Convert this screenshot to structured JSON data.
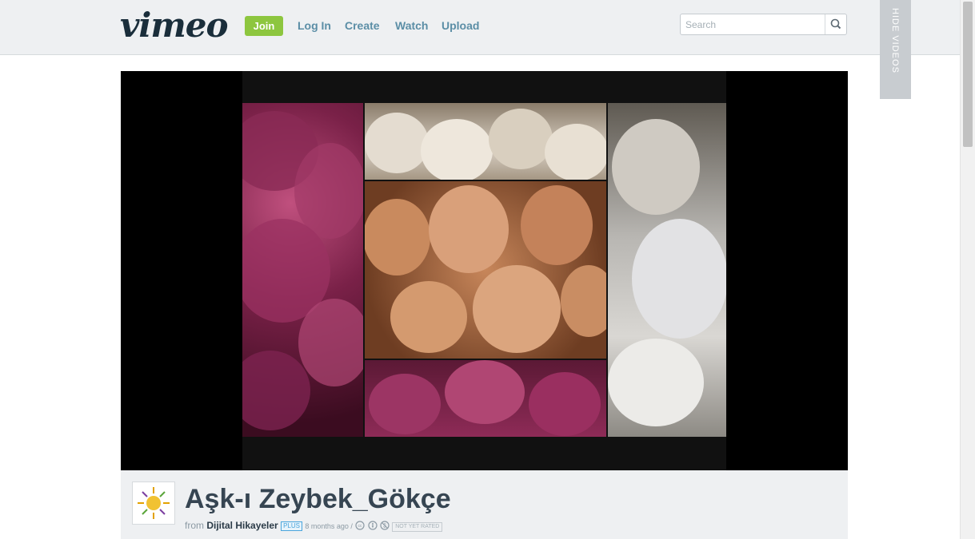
{
  "header": {
    "logo": "vimeo",
    "join_label": "Join",
    "nav": [
      "Log In",
      "Create",
      "Watch",
      "Upload"
    ],
    "search_placeholder": "Search",
    "hide_videos_label": "HIDE VIDEOS"
  },
  "video": {
    "title": "Aşk-ı Zeybek_Gökçe",
    "from_label": "from",
    "author": "Dijital Hikayeler",
    "plus_badge": "PLUS",
    "age": "8 months ago /",
    "rating_badge": "NOT YET RATED"
  },
  "colors": {
    "accent_green": "#8dc63f",
    "link_blue": "#5b8ea6",
    "header_bg": "#eef0f2"
  },
  "icons": [
    "search-icon",
    "creative-commons-icon",
    "attribution-icon",
    "noncommercial-icon",
    "sun-logo-icon"
  ]
}
